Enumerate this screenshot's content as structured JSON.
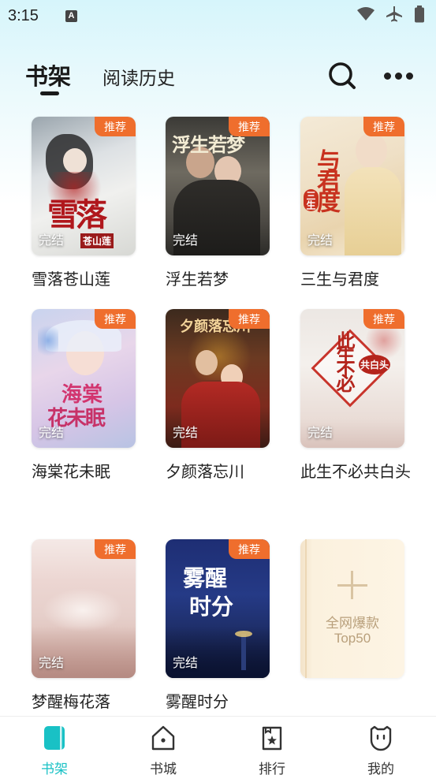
{
  "status_bar": {
    "time": "3:15",
    "notification_icon": "A"
  },
  "header": {
    "tab_shelf": "书架",
    "tab_history": "阅读历史"
  },
  "badges": {
    "recommend": "推荐",
    "completed": "完结"
  },
  "books": [
    {
      "title": "雪落苍山莲",
      "cover_text": "雪落",
      "cover_subtext": "苍山莲"
    },
    {
      "title": "浮生若梦",
      "cover_text": "浮生若梦",
      "cover_subtext": ""
    },
    {
      "title": "三生与君度",
      "cover_text": "与君度",
      "cover_subtext": "三生"
    },
    {
      "title": "海棠花未眠",
      "cover_text": "海棠",
      "cover_subtext": "花未眠"
    },
    {
      "title": "夕颜落忘川",
      "cover_text": "夕颜落忘川",
      "cover_subtext": ""
    },
    {
      "title": "此生不必共白头",
      "cover_text": "此生不必",
      "cover_subtext": "共白头"
    },
    {
      "title": "梦醒梅花落",
      "cover_text": "",
      "cover_subtext": ""
    },
    {
      "title": "雾醒时分",
      "cover_text": "雾醒",
      "cover_subtext": "时分"
    }
  ],
  "add_card": {
    "line1": "全网爆款",
    "line2": "Top50"
  },
  "bottom_nav": [
    {
      "label": "书架",
      "icon": "bookshelf-icon",
      "active": true
    },
    {
      "label": "书城",
      "icon": "bookstore-icon",
      "active": false
    },
    {
      "label": "排行",
      "icon": "ranking-icon",
      "active": false
    },
    {
      "label": "我的",
      "icon": "profile-icon",
      "active": false
    }
  ],
  "colors": {
    "accent": "#19c1c5",
    "badge": "#ef6e2d"
  }
}
